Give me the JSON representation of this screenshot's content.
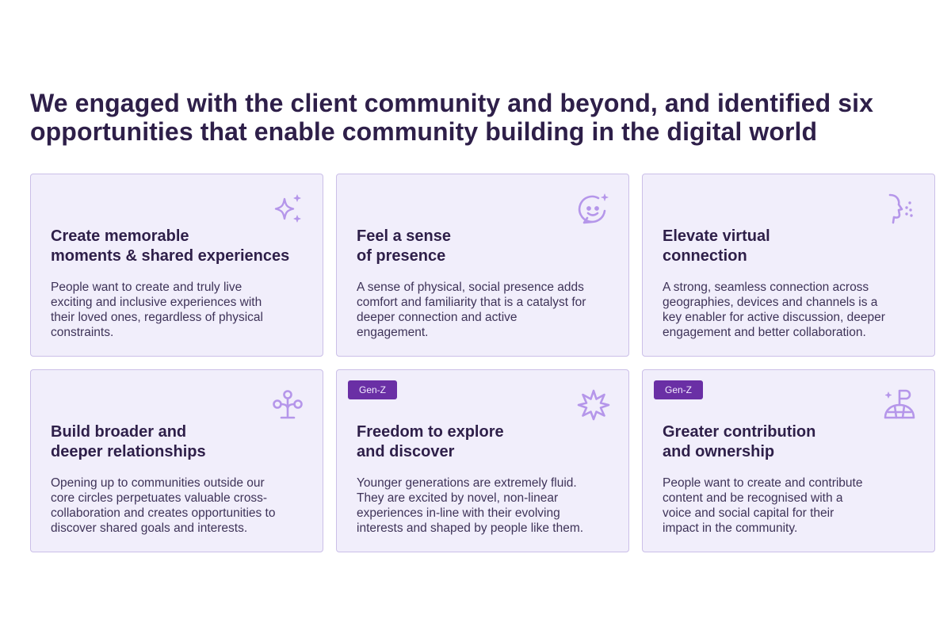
{
  "headline": {
    "line1": "We engaged with the client community and beyond, and identified six",
    "line2": "opportunities that enable community building in the digital world"
  },
  "colors": {
    "title": "#2e1f49",
    "card_background": "#f1eefb",
    "card_border": "#cbbfe8",
    "icon": "#b596ea",
    "badge": "#6a2fa5"
  },
  "cards": [
    {
      "icon": "sparkle-icon",
      "badge": "",
      "title": [
        "Create memorable",
        "moments & shared experiences"
      ],
      "body": [
        "People want to create and truly live",
        "exciting and inclusive experiences with",
        "their loved ones, regardless of physical",
        "constraints."
      ]
    },
    {
      "icon": "smile-chat-icon",
      "badge": "",
      "title": [
        "Feel a sense",
        "of presence"
      ],
      "body": [
        "A sense of physical, social presence adds",
        "comfort and familiarity that is a catalyst for",
        "deeper connection and active",
        "engagement."
      ]
    },
    {
      "icon": "face-profile-icon",
      "badge": "",
      "title": [
        "Elevate virtual",
        "connection"
      ],
      "body": [
        "A strong, seamless connection across",
        "geographies, devices and channels is a",
        "key enabler for active discussion, deeper",
        "engagement and better collaboration."
      ]
    },
    {
      "icon": "network-tree-icon",
      "badge": "",
      "title": [
        "Build broader and",
        "deeper relationships"
      ],
      "body": [
        "Opening up to communities outside our",
        "core circles perpetuates valuable cross-",
        "collaboration and creates opportunities to",
        "discover shared goals and interests."
      ]
    },
    {
      "icon": "starburst-icon",
      "badge": "Gen-Z",
      "title": [
        "Freedom to explore",
        "and discover"
      ],
      "body": [
        "Younger generations are extremely fluid.",
        "They are excited by novel, non-linear",
        "experiences in-line with their evolving",
        "interests and shaped by people like them."
      ]
    },
    {
      "icon": "flag-summit-icon",
      "badge": "Gen-Z",
      "title": [
        "Greater contribution",
        "and ownership"
      ],
      "body": [
        "People want to create and contribute",
        "content and be recognised with a",
        "voice and social capital  for their",
        "impact in the community."
      ]
    }
  ]
}
